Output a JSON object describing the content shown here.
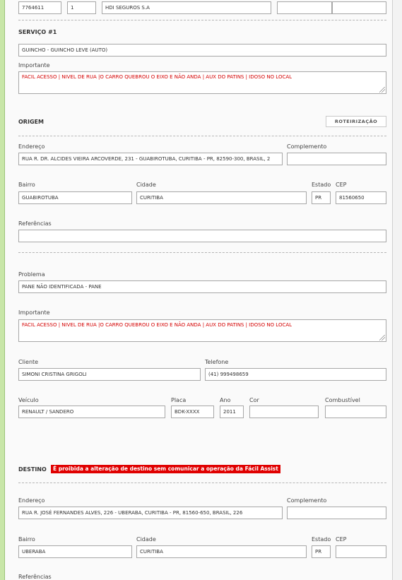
{
  "top_row": {
    "protocol": "7764611",
    "sequence": "1",
    "company": "HDI SEGUROS S.A",
    "extra1": "",
    "extra2": ""
  },
  "service": {
    "heading": "SERVIÇO #1",
    "type_value": "GUINCHO - GUINCHO LEVE (AUTO)",
    "important_label": "Importante",
    "important_value": "FACIL ACESSO | NIVEL DE RUA |O CARRO QUEBROU O EIXO E NÃO ANDA | AUX DO PATINS  | IDOSO NO LOCAL"
  },
  "origin": {
    "heading": "ORIGEM",
    "routing_button": "ROTEIRIZAÇÃO",
    "address_label": "Endereço",
    "address_value": "RUA R. DR. ALCIDES VIEIRA ARCOVERDE, 231 - GUABIROTUBA, CURITIBA - PR, 82590-300, BRASIL, 2",
    "complement_label": "Complemento",
    "complement_value": "",
    "neighborhood_label": "Bairro",
    "neighborhood_value": "GUABIROTUBA",
    "city_label": "Cidade",
    "city_value": "CURITIBA",
    "state_label": "Estado",
    "state_value": "PR",
    "zip_label": "CEP",
    "zip_value": "81560650",
    "references_label": "Referências",
    "references_value": ""
  },
  "problem": {
    "problem_label": "Problema",
    "problem_value": "PANE NÃO IDENTIFICADA - PANE",
    "important_label": "Importante",
    "important_value": "FACIL ACESSO | NIVEL DE RUA |O CARRO QUEBROU O EIXO E NÃO ANDA | AUX DO PATINS  | IDOSO NO LOCAL",
    "client_label": "Cliente",
    "client_value": "SIMONI CRISTINA GRIGOLI",
    "phone_label": "Telefone",
    "phone_value": "(41) 999498659",
    "vehicle_label": "Veículo",
    "vehicle_value": "RENAULT / SANDERO",
    "plate_label": "Placa",
    "plate_value": "BDK-XXXX",
    "year_label": "Ano",
    "year_value": "2011",
    "color_label": "Cor",
    "color_value": "",
    "fuel_label": "Combustível",
    "fuel_value": ""
  },
  "destination": {
    "heading": "DESTINO",
    "warning": "É proibida a alteração de destino sem comunicar a operação da Fácil Assist",
    "address_label": "Endereço",
    "address_value": "RUA R. JOSÉ FERNANDES ALVES, 226 - UBERABA, CURITIBA - PR, 81560-650, BRASIL, 226",
    "complement_label": "Complemento",
    "complement_value": "",
    "neighborhood_label": "Bairro",
    "neighborhood_value": "UBERABA",
    "city_label": "Cidade",
    "city_value": "CURITIBA",
    "state_label": "Estado",
    "state_value": "PR",
    "zip_label": "CEP",
    "zip_value": "",
    "references_label": "Referências"
  },
  "colors": {
    "important_text": "#d40000",
    "warning_bg": "#e00000",
    "left_bar": "#c8e6a8"
  }
}
